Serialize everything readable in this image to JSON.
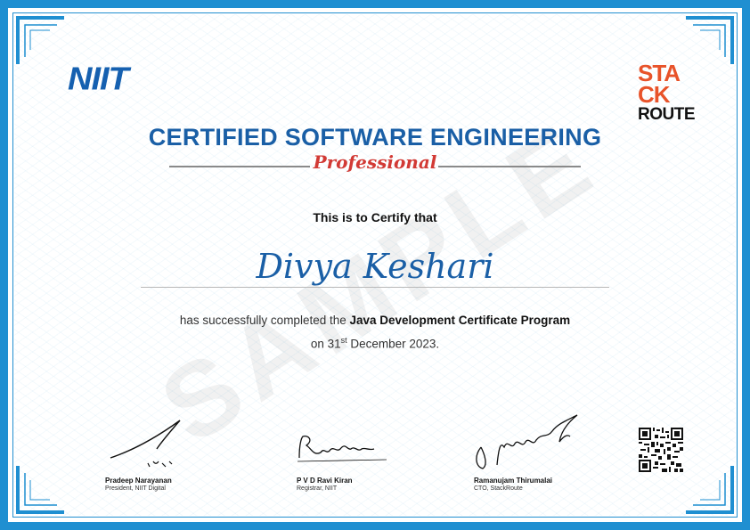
{
  "logos": {
    "niit": "NIIT",
    "stackroute_line1": "STA",
    "stackroute_line2": "CK",
    "stackroute_line3": "ROUTE"
  },
  "certificate": {
    "title": "CERTIFIED SOFTWARE ENGINEERING",
    "subtitle": "Professional",
    "certify_text": "This is to Certify that",
    "recipient": "Divya Keshari",
    "body_prefix": "has successfully completed the ",
    "program": "Java Development Certificate Program",
    "date_prefix": "on 31",
    "date_suffix": "st",
    "date_rest": " December 2023.",
    "watermark": "SAMPLE"
  },
  "signatories": [
    {
      "name": "Pradeep Narayanan",
      "role": "President, NIIT Digital"
    },
    {
      "name": "P V D Ravi Kiran",
      "role": "Registrar, NIIT"
    },
    {
      "name": "Ramanujam Thirumalai",
      "role": "CTO, StackRoute"
    }
  ],
  "colors": {
    "border": "#1f8fd1",
    "title": "#1a5fa6",
    "subtitle": "#d23a35",
    "stackroute_accent": "#e8532a"
  },
  "icons": {
    "qr": "qr-code-icon"
  }
}
